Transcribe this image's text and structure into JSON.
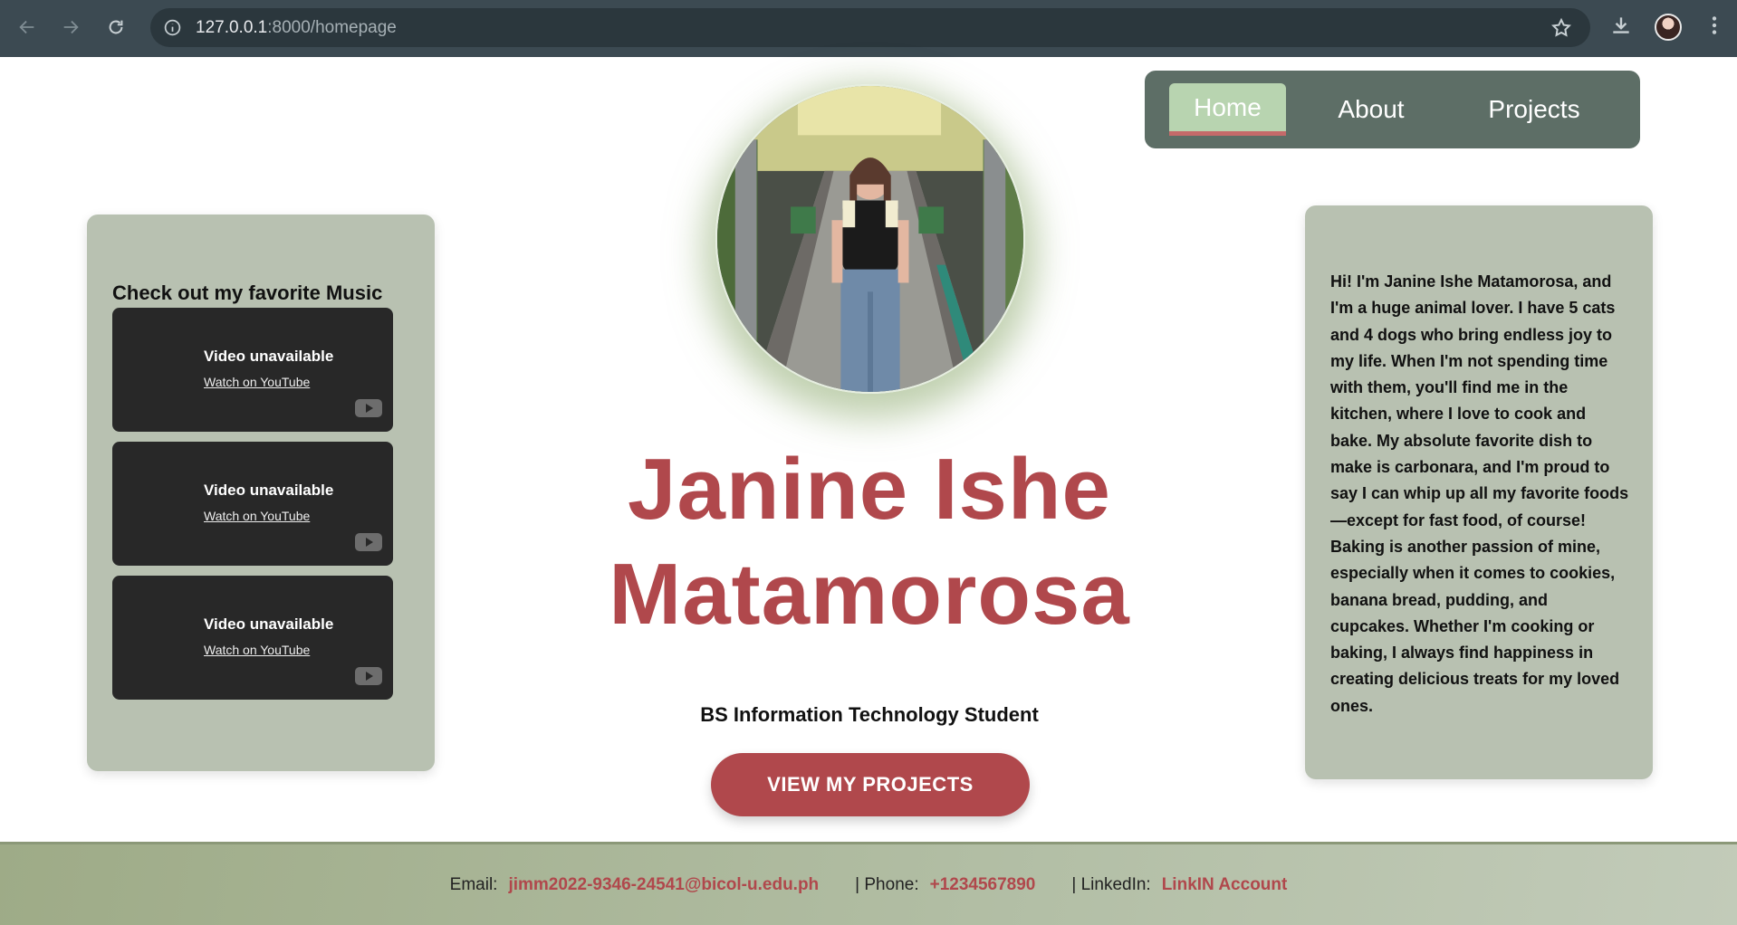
{
  "browser": {
    "url_host": "127.0.0.1",
    "url_rest": ":8000/homepage"
  },
  "nav": {
    "items": [
      {
        "label": "Home",
        "active": true
      },
      {
        "label": "About",
        "active": false
      },
      {
        "label": "Projects",
        "active": false
      }
    ]
  },
  "hero": {
    "name_line1": "Janine Ishe",
    "name_line2": "Matamorosa",
    "subtitle": "BS Information Technology Student",
    "cta_label": "VIEW MY PROJECTS"
  },
  "music": {
    "title": "Check out my favorite Music",
    "videos": [
      {
        "status": "Video unavailable",
        "link": "Watch on YouTube"
      },
      {
        "status": "Video unavailable",
        "link": "Watch on YouTube"
      },
      {
        "status": "Video unavailable",
        "link": "Watch on YouTube"
      }
    ]
  },
  "about": {
    "text": "Hi! I'm Janine Ishe Matamorosa, and I'm a huge animal lover. I have 5 cats and 4 dogs who bring endless joy to my life. When I'm not spending time with them, you'll find me in the kitchen, where I love to cook and bake. My absolute favorite dish to make is carbonara, and I'm proud to say I can whip up all my favorite foods—except for fast food, of course! Baking is another passion of mine, especially when it comes to cookies, banana bread, pudding, and cupcakes. Whether I'm cooking or baking, I always find happiness in creating delicious treats for my loved ones."
  },
  "footer": {
    "email_label": "Email:",
    "email_value": "jimm2022-9346-24541@bicol-u.edu.ph",
    "phone_label": "| Phone:",
    "phone_value": "+1234567890",
    "linkedin_label": "| LinkedIn:",
    "linkedin_value": "LinkIN Account"
  },
  "colors": {
    "accent": "#b0484c",
    "card": "#b8c1b1",
    "navbar": "#5d6e66",
    "nav_active": "#b8d4b0"
  },
  "icons": [
    "back-arrow-icon",
    "forward-arrow-icon",
    "reload-icon",
    "info-icon",
    "star-icon",
    "download-icon",
    "kebab-menu-icon",
    "youtube-icon"
  ]
}
